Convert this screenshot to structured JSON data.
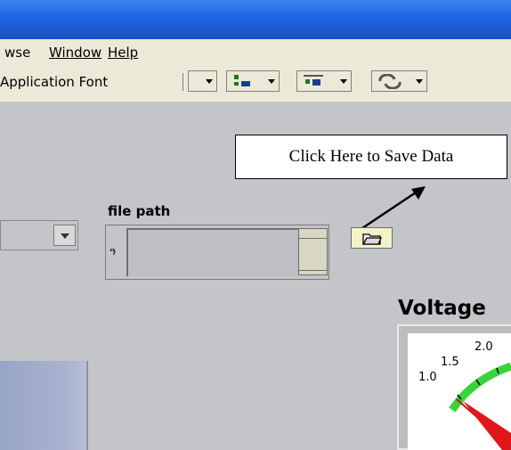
{
  "menu": {
    "items": [
      "wse",
      "Window",
      "Help"
    ]
  },
  "toolbar": {
    "font": "Application Font"
  },
  "callout": {
    "text": "Click Here to Save Data"
  },
  "file_path": {
    "label": "file path",
    "icon": "path-icon"
  },
  "voltage": {
    "label": "Voltage",
    "ticks": [
      "1.0",
      "1.5",
      "2.0"
    ]
  },
  "colors": {
    "title_bar": "#1f63e0",
    "panel": "#c4c5c8",
    "gauge_green": "#39d43b",
    "needle_red": "#e1161b"
  }
}
